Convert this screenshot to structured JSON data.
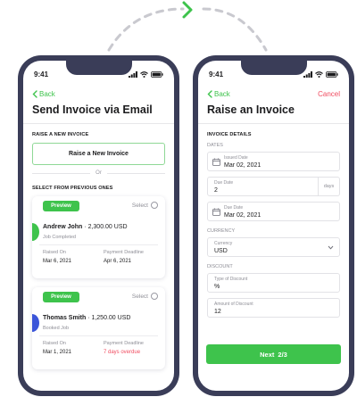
{
  "left": {
    "status": {
      "time": "9:41"
    },
    "nav": {
      "back_label": "Back"
    },
    "title": "Send Invoice via Email",
    "section_raise": "RAISE A NEW INVOICE",
    "raise_button": "Raise a New Invoice",
    "or_text": "Or",
    "section_previous": "SELECT FROM PREVIOUS ONES",
    "cards": [
      {
        "preview_label": "Preview",
        "select_label": "Select",
        "name": "Andrew John",
        "amount": " · 2,300.00 USD",
        "status_text": "Job Completed",
        "status_color": "#3ec34c",
        "raised_label": "Raised On",
        "raised_value": "Mar 6, 2021",
        "deadline_label": "Payment Deadline",
        "deadline_value": "Apr 6, 2021"
      },
      {
        "preview_label": "Preview",
        "select_label": "Select",
        "name": "Thomas Smith",
        "amount": " · 1,250.00 USD",
        "status_text": "Booked Job",
        "status_color": "#3b55d9",
        "raised_label": "Raised On",
        "raised_value": "Mar 1, 2021",
        "deadline_label": "Payment Deadline",
        "deadline_value": "7 days overdue"
      }
    ]
  },
  "right": {
    "status": {
      "time": "9:41"
    },
    "nav": {
      "back_label": "Back",
      "cancel_label": "Cancel"
    },
    "title": "Raise an Invoice",
    "section_details": "INVOICE DETAILS",
    "dates_label": "DATES",
    "issued": {
      "label": "Issued Date",
      "value": "Mar 02, 2021"
    },
    "due": {
      "label": "Due Date",
      "value": "2",
      "unit": "days"
    },
    "due_date": {
      "label": "Due Date",
      "value": "Mar 02, 2021"
    },
    "currency_label": "CURRENCY",
    "currency": {
      "label": "Currency",
      "value": "USD"
    },
    "discount_label": "DISCOUNT",
    "discount_type": {
      "label": "Type of Discount",
      "value": "%"
    },
    "discount_amount": {
      "label": "Amount of Discount",
      "value": "12"
    },
    "next_button": {
      "label": "Next",
      "step": "2/3"
    }
  },
  "colors": {
    "accent": "#3ec34c",
    "danger": "#f04c60",
    "frame": "#3a3d58"
  }
}
